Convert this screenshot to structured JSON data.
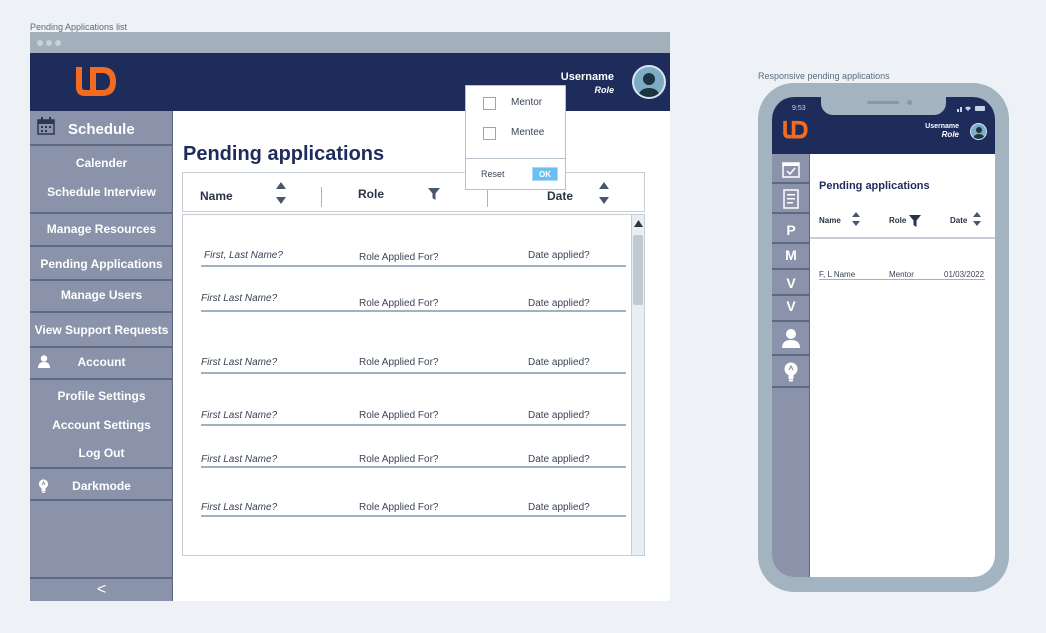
{
  "captions": {
    "desktop": "Pending Applications list",
    "mobile": "Responsive pending applications"
  },
  "header": {
    "username": "Username",
    "role": "Role"
  },
  "sidebar": {
    "schedule_title": "Schedule",
    "items": [
      {
        "label": "Calender"
      },
      {
        "label": "Schedule Interview"
      },
      {
        "label": "Manage Resources"
      },
      {
        "label": "Pending Applications"
      },
      {
        "label": "Manage Users"
      },
      {
        "label": "View Support Requests"
      },
      {
        "label": "Account"
      },
      {
        "label": "Profile Settings"
      },
      {
        "label": "Account Settings"
      },
      {
        "label": "Log Out"
      },
      {
        "label": "Darkmode"
      }
    ],
    "collapse_glyph": "<"
  },
  "main": {
    "title": "Pending applications",
    "columns": [
      "Name",
      "Role",
      "Date"
    ],
    "rows": [
      {
        "name": "First, Last Name?",
        "role": "Role Applied For?",
        "date": "Date applied?"
      },
      {
        "name": "First Last Name?",
        "role": "Role Applied For?",
        "date": "Date applied?"
      },
      {
        "name": "First Last Name?",
        "role": "Role Applied For?",
        "date": "Date applied?"
      },
      {
        "name": "First Last Name?",
        "role": "Role Applied For?",
        "date": "Date applied?"
      },
      {
        "name": "First Last Name?",
        "role": "Role Applied For?",
        "date": "Date applied?"
      },
      {
        "name": "First Last Name?",
        "role": "Role Applied For?",
        "date": "Date applied?"
      }
    ]
  },
  "filter_popup": {
    "options": [
      "Mentor",
      "Mentee"
    ],
    "reset": "Reset",
    "ok": "OK"
  },
  "mobile": {
    "status_time": "9:53",
    "username": "Username",
    "role": "Role",
    "side_letters": [
      "P",
      "M",
      "V",
      "V"
    ],
    "title": "Pending applications",
    "columns": [
      "Name",
      "Role",
      "Date"
    ],
    "row": {
      "name": "F, L Name",
      "role": "Mentor",
      "date": "01/03/2022"
    }
  },
  "colors": {
    "navy": "#1d2c5b",
    "sidebar": "#8a93a9",
    "logo_orange": "#f36b21",
    "ok_blue": "#6bbff3"
  }
}
